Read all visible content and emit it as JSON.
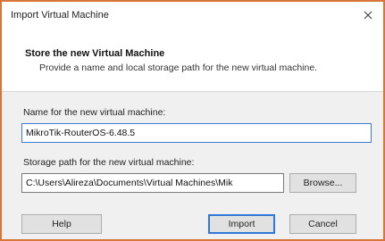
{
  "window": {
    "title": "Import Virtual Machine"
  },
  "header": {
    "title": "Store the new Virtual Machine",
    "subtitle": "Provide a name and local storage path for the new virtual machine."
  },
  "form": {
    "name_label": "Name for the new virtual machine:",
    "name_value": "MikroTik-RouterOS-6.48.5",
    "path_label": "Storage path for the new virtual machine:",
    "path_value": "C:\\Users\\Alireza\\Documents\\Virtual Machines\\Mik",
    "browse_label": "Browse..."
  },
  "footer": {
    "help_label": "Help",
    "import_label": "Import",
    "cancel_label": "Cancel"
  },
  "colors": {
    "window_border": "#d8763a",
    "accent": "#2f78d8"
  },
  "icons": {
    "close": "close-icon"
  }
}
